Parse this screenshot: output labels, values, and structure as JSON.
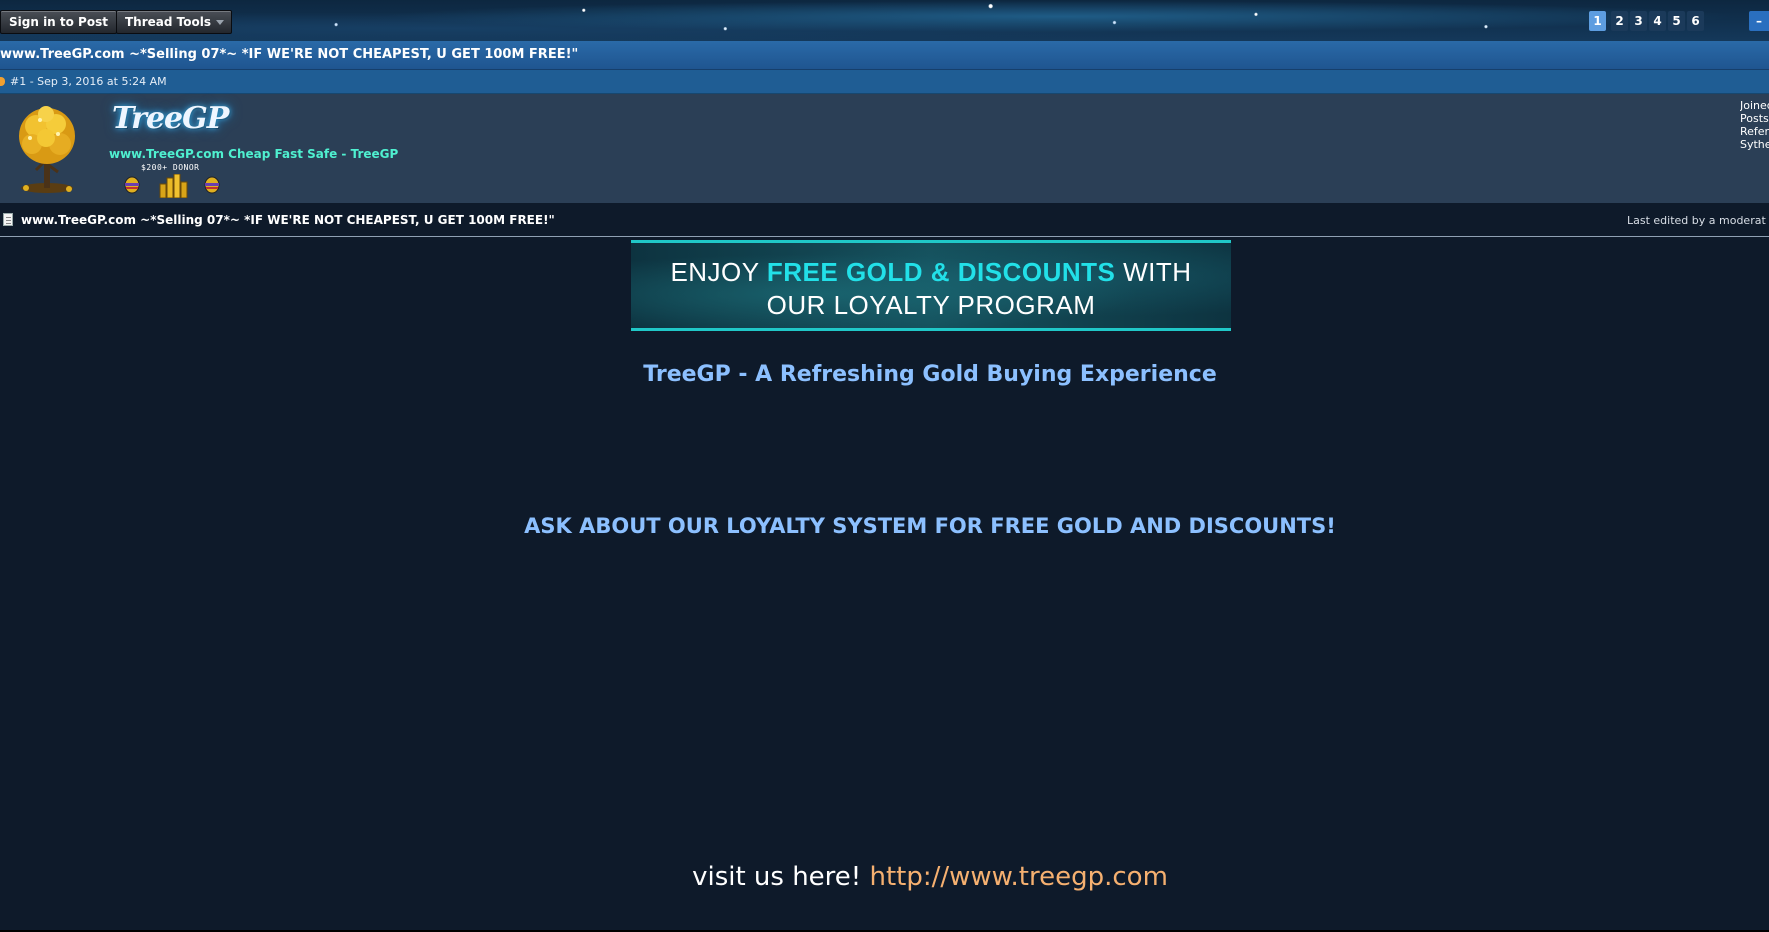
{
  "toolbar": {
    "sign_in_label": "Sign in to Post",
    "thread_tools_label": "Thread Tools"
  },
  "pagination": {
    "pages": [
      "1",
      "2",
      "3",
      "4",
      "5",
      "6"
    ],
    "current": "1",
    "tail_label": "–"
  },
  "thread": {
    "title": "www.TreeGP.com ~*Selling 07*~ *IF WE'RE NOT CHEAPEST, U GET 100M FREE!\""
  },
  "post": {
    "meta": "#1 - Sep 3, 2016 at 5:24 AM",
    "title": "www.TreeGP.com ~*Selling 07*~ *IF WE'RE NOT CHEAPEST, U GET 100M FREE!\"",
    "last_edited": "Last edited by a moderat"
  },
  "user": {
    "logo_text": "TreeGP",
    "user_title": "www.TreeGP.com Cheap Fast Safe - TreeGP",
    "donor_label": "$200+ DONOR",
    "stats": [
      "Joined",
      "Posts",
      "Referrals",
      "Sythe"
    ]
  },
  "body": {
    "banner": {
      "line1_pre": "ENJOY ",
      "line1_highlight": "FREE GOLD & DISCOUNTS",
      "line1_post": " WITH",
      "line2": "OUR LOYALTY PROGRAM"
    },
    "tagline": "TreeGP - A Refreshing Gold Buying Experience",
    "loyalty": "ASK ABOUT OUR LOYALTY SYSTEM FOR FREE GOLD AND DISCOUNTS!",
    "visit_prefix": "visit us here! ",
    "visit_link": "http://www.treegp.com"
  },
  "colors": {
    "page_bg": "#0e1a2a",
    "title_bar": "#2a6aa8",
    "user_panel": "#2b3f56",
    "accent_cyan": "#22e0e8",
    "link_blue": "#8cc0ff",
    "link_orange": "#f5b070",
    "user_title_green": "#4ff0d0"
  },
  "icons": [
    "document-icon",
    "avatar-gold-tree",
    "egg-award-icon",
    "gold-coins-award-icon",
    "caret-down-icon"
  ]
}
